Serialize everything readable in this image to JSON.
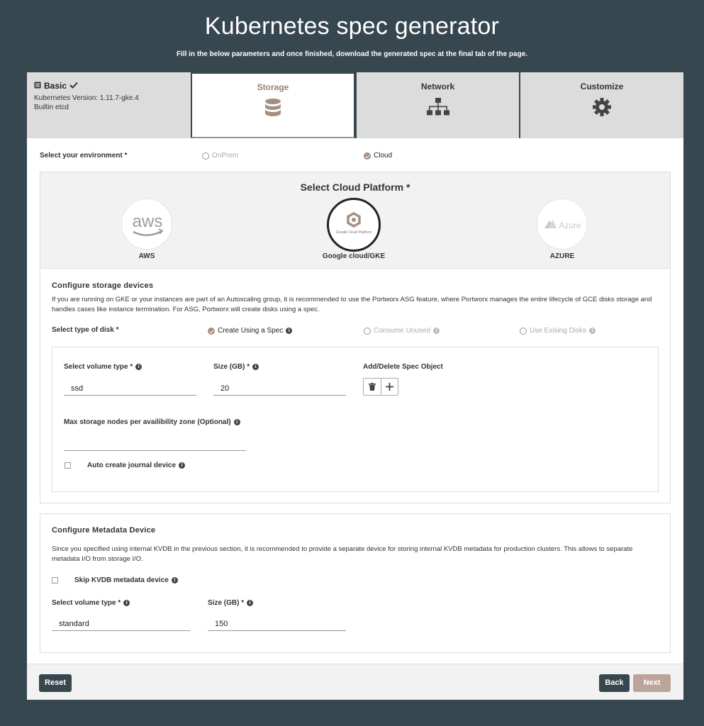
{
  "header": {
    "title": "Kubernetes spec generator",
    "subtitle": "Fill in the below parameters and once finished, download the generated spec at the final tab of the page."
  },
  "tabs": {
    "basic": {
      "label": "Basic",
      "version": "Kubernetes Version: 1.11.7-gke.4",
      "etcd": "Builtin etcd",
      "icon": "document-icon",
      "status_icon": "checkmark-icon"
    },
    "storage": {
      "label": "Storage",
      "icon": "database-icon"
    },
    "network": {
      "label": "Network",
      "icon": "network-icon"
    },
    "customize": {
      "label": "Customize",
      "icon": "gear-icon"
    }
  },
  "environment": {
    "label": "Select your environment *",
    "options": [
      "OnPrem",
      "Cloud"
    ],
    "selected": "Cloud"
  },
  "platform": {
    "title": "Select Cloud Platform *",
    "options": [
      {
        "label": "AWS",
        "logo_text": "aws"
      },
      {
        "label": "Google cloud/GKE",
        "logo_text": "Google Cloud Platform"
      },
      {
        "label": "AZURE",
        "logo_text": "Azure"
      }
    ],
    "selected": "Google cloud/GKE"
  },
  "storage_devices": {
    "title": "Configure storage devices",
    "description": "If you are running on GKE or your instances are part of an Autoscaling group, it is recommended to use the Portworx ASG feature, where Portworx manages the entire lifecycle of GCE disks storage and handles cases like instance termination. For ASG, Portworx will create disks using a spec.",
    "disk_type_label": "Select type of disk *",
    "disk_options": [
      "Create Using a Spec",
      "Consume Unused",
      "Use Exising Disks"
    ],
    "selected_disk": "Create Using a Spec",
    "volume_type_label": "Select volume type *",
    "volume_type_value": "ssd",
    "size_label": "Size (GB) *",
    "size_value": "20",
    "spec_object_label": "Add/Delete Spec Object",
    "max_nodes_label": "Max storage nodes per availibility zone (Optional)",
    "max_nodes_value": "",
    "journal_label": "Auto create journal device",
    "journal_checked": false
  },
  "metadata_device": {
    "title": "Configure Metadata Device",
    "description": "Since you specified using internal KVDB in the previous section, it is recommended to provide a separate device for storing internal KVDB metadata for production clusters. This allows to separate metadata I/O from storage I/O.",
    "skip_label": "Skip KVDB metadata device",
    "skip_checked": false,
    "volume_type_label": "Select volume type *",
    "volume_type_value": "standard",
    "size_label": "Size (GB) *",
    "size_value": "150"
  },
  "footer": {
    "reset": "Reset",
    "back": "Back",
    "next": "Next"
  },
  "colors": {
    "background": "#37474f",
    "accent": "#a58f83",
    "next_button": "#bba59a"
  }
}
